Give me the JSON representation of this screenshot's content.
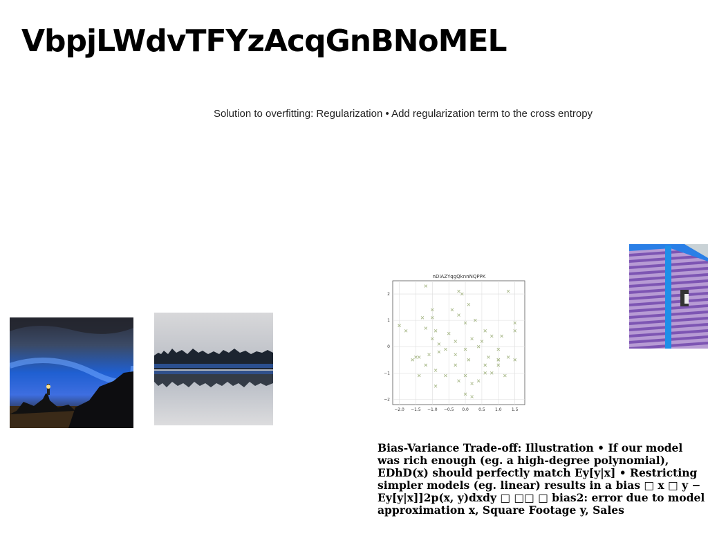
{
  "slide": {
    "title": "VbpjLWdvTFYzAcqGnBNoMEL",
    "subtitle": "Solution to overfitting: Regularization • Add regularization term to the cross entropy",
    "body": "Bias-Variance Trade-off: Illustration • If our model was rich enough (eg. a high-degree polynomial), EDhD(x) should perfectly match Ey[y|x] • Restricting simpler models (eg. linear) results in a bias □ x □ y − Ey[y|x]]2p(x, y)dxdy □ □□ □ bias2: error due to model approximation x, Square Footage y, Sales"
  },
  "images": {
    "lighthouse": "night-sky-lighthouse-photo",
    "lake": "forest-lake-reflection-photo",
    "building": "purple-siding-building-photo"
  },
  "chart_data": {
    "type": "scatter",
    "title": "nDiAZYqgQknnNQPPK",
    "xlabel": "",
    "ylabel": "",
    "xlim": [
      -2.2,
      1.8
    ],
    "ylim": [
      -2.2,
      2.5
    ],
    "xticks": [
      -2.0,
      -1.5,
      -1.0,
      -0.5,
      0.0,
      0.5,
      1.0,
      1.5
    ],
    "yticks": [
      2,
      1,
      0,
      -1,
      -2
    ],
    "grid": true,
    "marker": "x",
    "color": "#a9b98a",
    "points": [
      [
        -1.2,
        2.3
      ],
      [
        -0.2,
        2.1
      ],
      [
        1.3,
        2.1
      ],
      [
        -0.1,
        2.0
      ],
      [
        0.1,
        1.6
      ],
      [
        -1.0,
        1.4
      ],
      [
        -0.4,
        1.4
      ],
      [
        0.3,
        1.0
      ],
      [
        1.5,
        0.9
      ],
      [
        -1.3,
        1.1
      ],
      [
        -1.0,
        1.1
      ],
      [
        -0.2,
        1.2
      ],
      [
        -2.0,
        0.8
      ],
      [
        -1.8,
        0.6
      ],
      [
        -1.2,
        0.7
      ],
      [
        -0.9,
        0.6
      ],
      [
        -0.5,
        0.5
      ],
      [
        0.0,
        0.9
      ],
      [
        0.6,
        0.6
      ],
      [
        0.8,
        0.4
      ],
      [
        1.1,
        0.4
      ],
      [
        1.5,
        0.6
      ],
      [
        -0.3,
        0.2
      ],
      [
        0.2,
        0.3
      ],
      [
        0.5,
        0.2
      ],
      [
        -1.0,
        0.3
      ],
      [
        -0.8,
        0.1
      ],
      [
        -0.6,
        -0.1
      ],
      [
        0.0,
        -0.1
      ],
      [
        0.4,
        0.0
      ],
      [
        1.0,
        -0.1
      ],
      [
        -1.1,
        -0.3
      ],
      [
        -1.4,
        -0.4
      ],
      [
        -1.6,
        -0.5
      ],
      [
        -0.8,
        -0.2
      ],
      [
        -0.3,
        -0.3
      ],
      [
        0.1,
        -0.5
      ],
      [
        0.7,
        -0.4
      ],
      [
        1.0,
        -0.5
      ],
      [
        1.3,
        -0.4
      ],
      [
        1.5,
        -0.5
      ],
      [
        -1.5,
        -0.4
      ],
      [
        -1.2,
        -0.7
      ],
      [
        -0.3,
        -0.7
      ],
      [
        0.6,
        -0.7
      ],
      [
        0.8,
        -1.0
      ],
      [
        -0.9,
        -0.9
      ],
      [
        -0.6,
        -1.1
      ],
      [
        0.0,
        -1.1
      ],
      [
        0.4,
        -1.3
      ],
      [
        1.0,
        -0.7
      ],
      [
        1.2,
        -1.1
      ],
      [
        -1.4,
        -1.1
      ],
      [
        -0.9,
        -1.5
      ],
      [
        0.2,
        -1.4
      ],
      [
        0.6,
        -1.0
      ],
      [
        0.0,
        -1.8
      ],
      [
        0.2,
        -1.9
      ],
      [
        -0.2,
        -1.3
      ],
      [
        1.0,
        -0.5
      ]
    ]
  }
}
